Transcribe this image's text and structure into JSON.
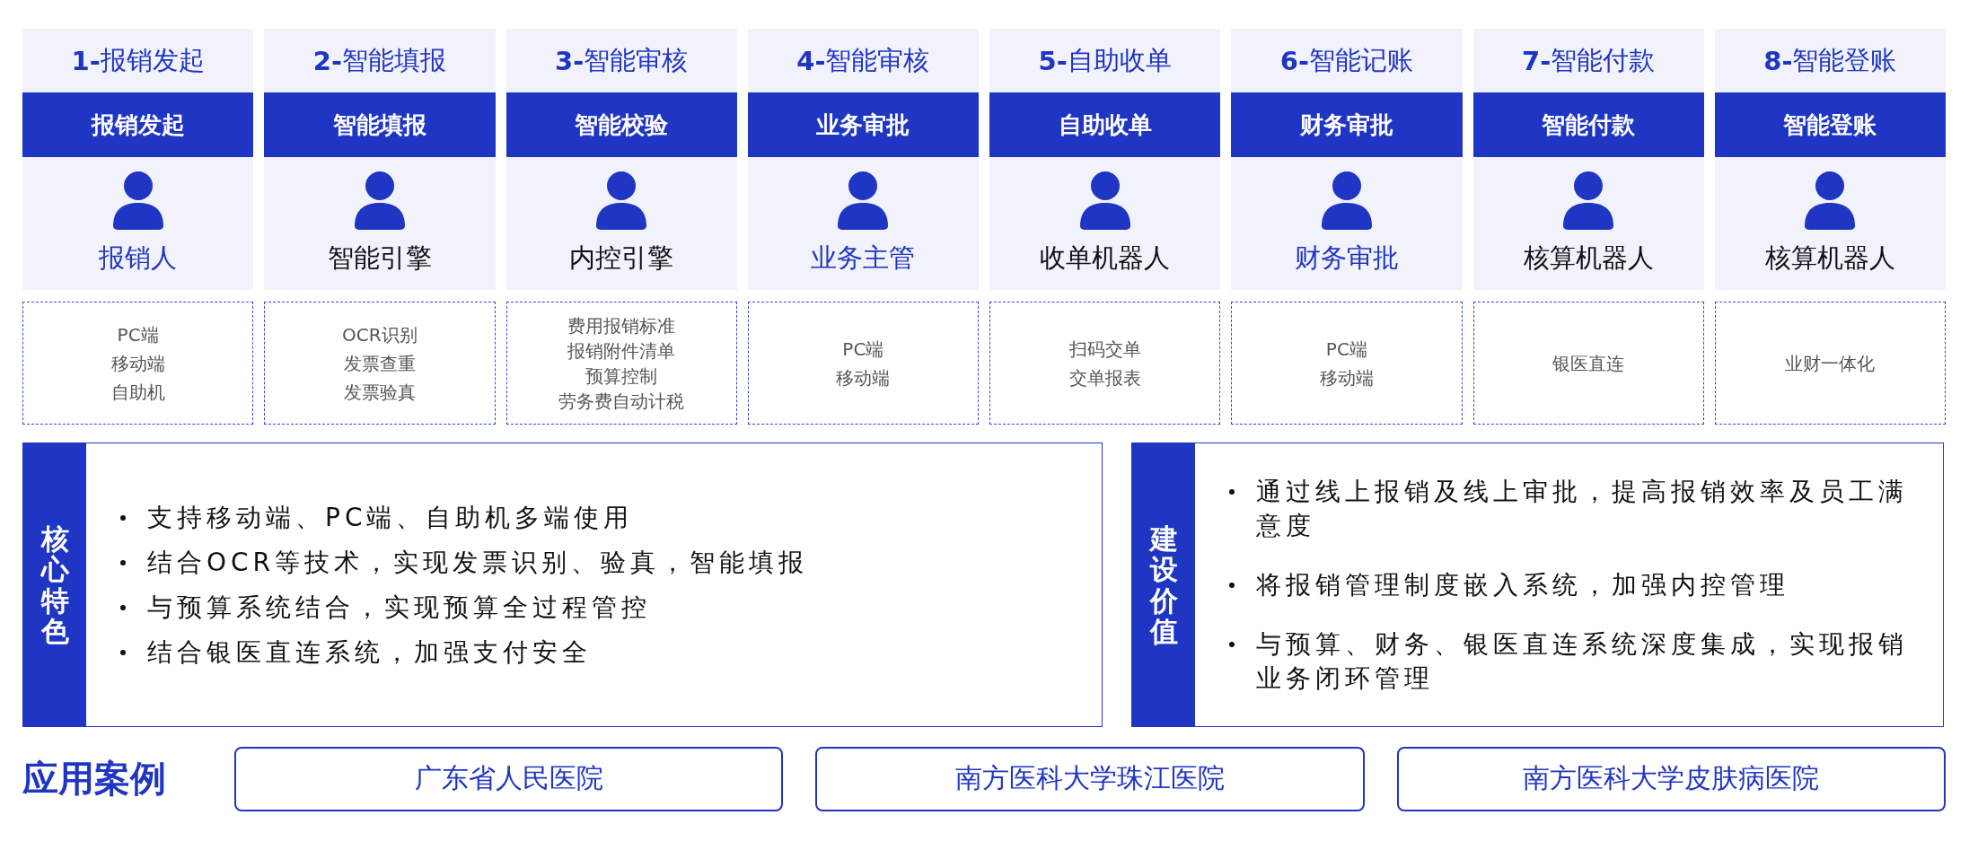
{
  "steps": [
    {
      "number": "1-",
      "title": "报销发起",
      "action": "报销发起",
      "role": "报销人",
      "color": "#1f35c4",
      "channels": [
        "PC端",
        "移动端",
        "自助机"
      ]
    },
    {
      "number": "2-",
      "title": "智能填报",
      "action": "智能填报",
      "role": "智能引擎",
      "color": "#111111",
      "channels": [
        "OCR识别",
        "发票查重",
        "发票验真"
      ]
    },
    {
      "number": "3-",
      "title": "智能审核",
      "action": "智能校验",
      "role": "内控引擎",
      "color": "#111111",
      "channels": [
        "费用报销标准",
        "报销附件清单",
        "预算控制",
        "劳务费自动计税"
      ]
    },
    {
      "number": "4-",
      "title": "智能审核",
      "action": "业务审批",
      "role": "业务主管",
      "color": "#1f35c4",
      "channels": [
        "PC端",
        "移动端"
      ]
    },
    {
      "number": "5-",
      "title": "自助收单",
      "action": "自助收单",
      "role": "收单机器人",
      "color": "#111111",
      "channels": [
        "扫码交单",
        "交单报表"
      ]
    },
    {
      "number": "6-",
      "title": "智能记账",
      "action": "财务审批",
      "role": "财务审批",
      "color": "#1f35c4",
      "channels": [
        "PC端",
        "移动端"
      ]
    },
    {
      "number": "7-",
      "title": "智能付款",
      "action": "智能付款",
      "role": "核算机器人",
      "color": "#111111",
      "channels": [
        "银医直连"
      ]
    },
    {
      "number": "8-",
      "title": "智能登账",
      "action": "智能登账",
      "role": "核算机器人",
      "color": "#111111",
      "channels": [
        "业财一体化"
      ]
    }
  ],
  "panels": [
    {
      "label": "核心特色",
      "bullets": [
        "支持移动端、PC端、自助机多端使用",
        "结合OCR等技术，实现发票识别、验真，智能填报",
        "与预算系统结合，实现预算全过程管控",
        "结合银医直连系统，加强支付安全"
      ]
    },
    {
      "label": "建设价值",
      "bullets": [
        "通过线上报销及线上审批，提高报销效率及员工满意度",
        "将报销管理制度嵌入系统，加强内控管理",
        "与预算、财务、银医直连系统深度集成，实现报销业务闭环管理"
      ]
    }
  ],
  "cases": {
    "label": "应用案例",
    "items": [
      "广东省人民医院",
      "南方医科大学珠江医院",
      "南方医科大学皮肤病医院"
    ]
  }
}
